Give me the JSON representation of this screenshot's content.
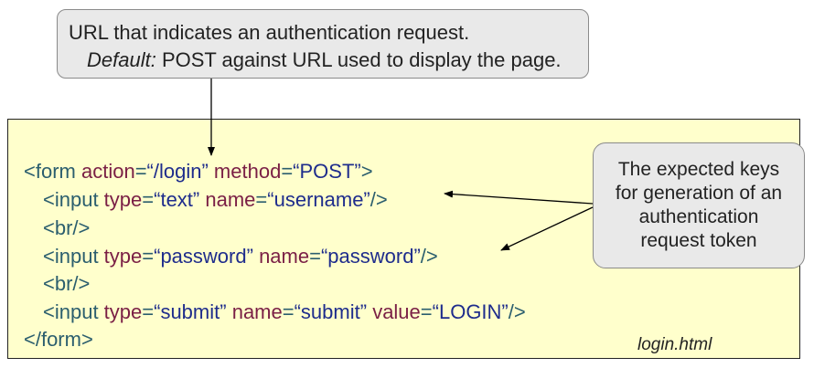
{
  "top_callout": {
    "line1": "URL that indicates an authentication request.",
    "default_label": "Default:",
    "line2_rest": " POST against URL used to display the page."
  },
  "code": {
    "line1": {
      "open": "<form ",
      "a1": "action",
      "eq1": "=",
      "v1": "“/login”",
      "sp": " ",
      "a2": "method",
      "eq2": "=",
      "v2": "“POST”",
      "close": ">"
    },
    "line2": {
      "open": "<input ",
      "a1": "type",
      "eq1": "=",
      "v1": "“text”",
      "sp": " ",
      "a2": "name",
      "eq2": "=",
      "v2": "“username”",
      "close": "/>"
    },
    "line3": "<br/>",
    "line4": {
      "open": "<input ",
      "a1": "type",
      "eq1": "=",
      "v1": "“password”",
      "sp": " ",
      "a2": "name",
      "eq2": "=",
      "v2": "“password”",
      "close": "/>"
    },
    "line5": "<br/>",
    "line6": {
      "open": "<input ",
      "a1": "type",
      "eq1": "=",
      "v1": "“submit”",
      "sp": " ",
      "a2": "name",
      "eq2": "=",
      "v2": "“submit”",
      "sp2": " ",
      "a3": "value",
      "eq3": "=",
      "v3": "“LOGIN”",
      "close": "/>"
    },
    "line7": "</form>"
  },
  "file_label": "login.html",
  "right_callout": {
    "lines": [
      "The expected keys",
      "for generation of an",
      "authentication",
      "request token"
    ]
  }
}
